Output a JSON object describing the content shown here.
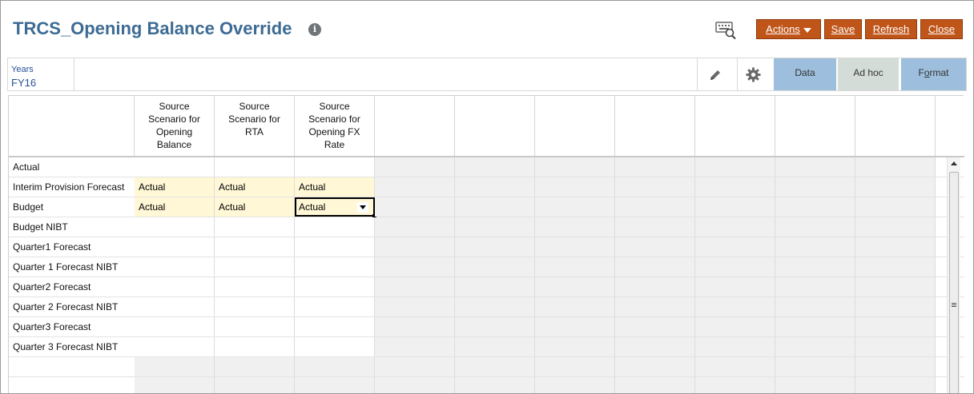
{
  "header": {
    "title": "TRCS_Opening Balance Override",
    "info_icon": "i",
    "buttons": {
      "actions": "Actions",
      "save": "Save",
      "refresh": "Refresh",
      "close": "Close"
    },
    "accent_color": "#c0551a",
    "title_color": "#3d6b93"
  },
  "pov": {
    "label": "Years",
    "value": "FY16"
  },
  "tabs": {
    "data": "Data",
    "adhoc": "Ad hoc",
    "format_pre": "F",
    "format_u": "o",
    "format_post": "rmat"
  },
  "grid": {
    "columns": [
      "Source Scenario for Opening Balance",
      "Source Scenario for RTA",
      "Source Scenario for Opening FX Rate"
    ],
    "rows": [
      {
        "label": "Actual",
        "cells": [
          "",
          "",
          ""
        ],
        "style": [
          "w",
          "w",
          "w"
        ]
      },
      {
        "label": "Interim Provision Forecast",
        "cells": [
          "Actual",
          "Actual",
          "Actual"
        ],
        "style": [
          "y",
          "y",
          "y"
        ]
      },
      {
        "label": "Budget",
        "cells": [
          "Actual",
          "Actual",
          "Actual"
        ],
        "style": [
          "y",
          "y",
          "sel"
        ]
      },
      {
        "label": "Budget NIBT",
        "cells": [
          "",
          "",
          ""
        ],
        "style": [
          "w",
          "w",
          "w"
        ]
      },
      {
        "label": "Quarter1 Forecast",
        "cells": [
          "",
          "",
          ""
        ],
        "style": [
          "w",
          "w",
          "w"
        ]
      },
      {
        "label": "Quarter 1 Forecast NIBT",
        "cells": [
          "",
          "",
          ""
        ],
        "style": [
          "w",
          "w",
          "w"
        ]
      },
      {
        "label": "Quarter2 Forecast",
        "cells": [
          "",
          "",
          ""
        ],
        "style": [
          "w",
          "w",
          "w"
        ]
      },
      {
        "label": "Quarter 2 Forecast NIBT",
        "cells": [
          "",
          "",
          ""
        ],
        "style": [
          "w",
          "w",
          "w"
        ]
      },
      {
        "label": "Quarter3 Forecast",
        "cells": [
          "",
          "",
          ""
        ],
        "style": [
          "w",
          "w",
          "w"
        ]
      },
      {
        "label": "Quarter 3 Forecast NIBT",
        "cells": [
          "",
          "",
          ""
        ],
        "style": [
          "w",
          "w",
          "w"
        ]
      }
    ]
  }
}
